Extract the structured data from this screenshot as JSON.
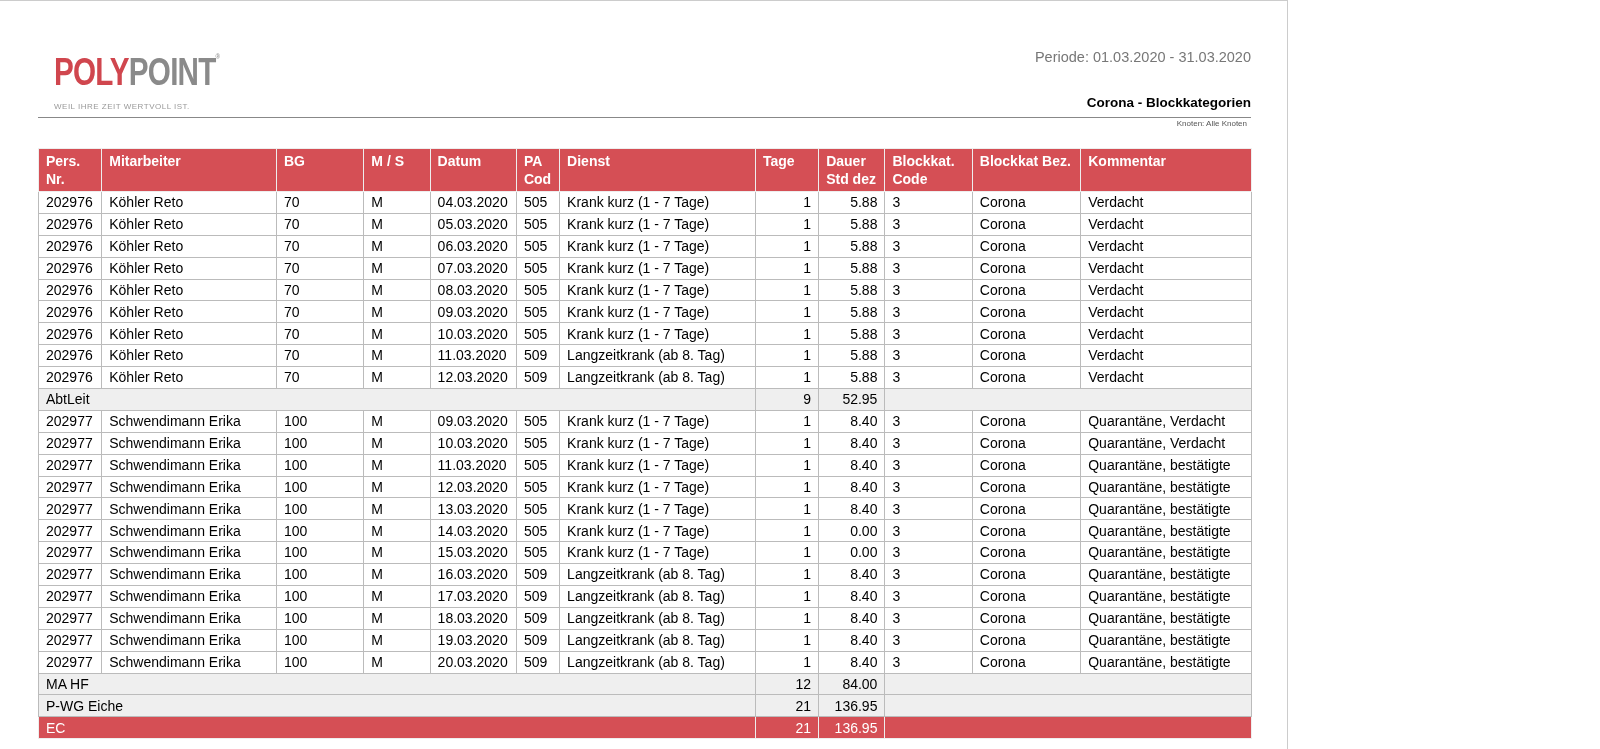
{
  "logo": {
    "part1": "POLY",
    "part2": "POINT",
    "mark": "®",
    "tagline": "WEIL IHRE ZEIT WERTVOLL IST."
  },
  "period": "Periode: 01.03.2020 - 31.03.2020",
  "report_title": "Corona - Blockkategorien",
  "node_filter": "Knoten: Alle Knoten",
  "table": {
    "columns": [
      {
        "label": "Pers. Nr.",
        "kind": "text"
      },
      {
        "label": "Mitarbeiter",
        "kind": "text"
      },
      {
        "label": "BG",
        "kind": "text"
      },
      {
        "label": "M / S",
        "kind": "text"
      },
      {
        "label": "Datum",
        "kind": "text"
      },
      {
        "label": "PA Cod",
        "kind": "text"
      },
      {
        "label": "Dienst",
        "kind": "text"
      },
      {
        "label": "Tage",
        "kind": "number"
      },
      {
        "label": "Dauer Std dez",
        "kind": "number"
      },
      {
        "label": "Blockkat. Code",
        "kind": "text"
      },
      {
        "label": "Blockkat Bez.",
        "kind": "text"
      },
      {
        "label": "Kommentar",
        "kind": "text"
      }
    ],
    "rows": [
      {
        "kind": "data",
        "cells": [
          "202976",
          "Köhler Reto",
          "70",
          "M",
          "04.03.2020",
          "505",
          "Krank kurz (1 - 7 Tage)",
          "1",
          "5.88",
          "3",
          "Corona",
          "Verdacht"
        ]
      },
      {
        "kind": "data",
        "cells": [
          "202976",
          "Köhler Reto",
          "70",
          "M",
          "05.03.2020",
          "505",
          "Krank kurz (1 - 7 Tage)",
          "1",
          "5.88",
          "3",
          "Corona",
          "Verdacht"
        ]
      },
      {
        "kind": "data",
        "cells": [
          "202976",
          "Köhler Reto",
          "70",
          "M",
          "06.03.2020",
          "505",
          "Krank kurz (1 - 7 Tage)",
          "1",
          "5.88",
          "3",
          "Corona",
          "Verdacht"
        ]
      },
      {
        "kind": "data",
        "cells": [
          "202976",
          "Köhler Reto",
          "70",
          "M",
          "07.03.2020",
          "505",
          "Krank kurz (1 - 7 Tage)",
          "1",
          "5.88",
          "3",
          "Corona",
          "Verdacht"
        ]
      },
      {
        "kind": "data",
        "cells": [
          "202976",
          "Köhler Reto",
          "70",
          "M",
          "08.03.2020",
          "505",
          "Krank kurz (1 - 7 Tage)",
          "1",
          "5.88",
          "3",
          "Corona",
          "Verdacht"
        ]
      },
      {
        "kind": "data",
        "cells": [
          "202976",
          "Köhler Reto",
          "70",
          "M",
          "09.03.2020",
          "505",
          "Krank kurz (1 - 7 Tage)",
          "1",
          "5.88",
          "3",
          "Corona",
          "Verdacht"
        ]
      },
      {
        "kind": "data",
        "cells": [
          "202976",
          "Köhler Reto",
          "70",
          "M",
          "10.03.2020",
          "505",
          "Krank kurz (1 - 7 Tage)",
          "1",
          "5.88",
          "3",
          "Corona",
          "Verdacht"
        ]
      },
      {
        "kind": "data",
        "cells": [
          "202976",
          "Köhler Reto",
          "70",
          "M",
          "11.03.2020",
          "509",
          "Langzeitkrank (ab 8. Tag)",
          "1",
          "5.88",
          "3",
          "Corona",
          "Verdacht"
        ]
      },
      {
        "kind": "data",
        "cells": [
          "202976",
          "Köhler Reto",
          "70",
          "M",
          "12.03.2020",
          "509",
          "Langzeitkrank (ab 8. Tag)",
          "1",
          "5.88",
          "3",
          "Corona",
          "Verdacht"
        ]
      },
      {
        "kind": "subtotal",
        "label": "AbtLeit",
        "tage": "9",
        "dauer": "52.95"
      },
      {
        "kind": "data",
        "cells": [
          "202977",
          "Schwendimann Erika",
          "100",
          "M",
          "09.03.2020",
          "505",
          "Krank kurz (1 - 7 Tage)",
          "1",
          "8.40",
          "3",
          "Corona",
          "Quarantäne, Verdacht"
        ]
      },
      {
        "kind": "data",
        "cells": [
          "202977",
          "Schwendimann Erika",
          "100",
          "M",
          "10.03.2020",
          "505",
          "Krank kurz (1 - 7 Tage)",
          "1",
          "8.40",
          "3",
          "Corona",
          "Quarantäne, Verdacht"
        ]
      },
      {
        "kind": "data",
        "cells": [
          "202977",
          "Schwendimann Erika",
          "100",
          "M",
          "11.03.2020",
          "505",
          "Krank kurz (1 - 7 Tage)",
          "1",
          "8.40",
          "3",
          "Corona",
          "Quarantäne, bestätigte"
        ]
      },
      {
        "kind": "data",
        "cells": [
          "202977",
          "Schwendimann Erika",
          "100",
          "M",
          "12.03.2020",
          "505",
          "Krank kurz (1 - 7 Tage)",
          "1",
          "8.40",
          "3",
          "Corona",
          "Quarantäne, bestätigte"
        ]
      },
      {
        "kind": "data",
        "cells": [
          "202977",
          "Schwendimann Erika",
          "100",
          "M",
          "13.03.2020",
          "505",
          "Krank kurz (1 - 7 Tage)",
          "1",
          "8.40",
          "3",
          "Corona",
          "Quarantäne, bestätigte"
        ]
      },
      {
        "kind": "data",
        "cells": [
          "202977",
          "Schwendimann Erika",
          "100",
          "M",
          "14.03.2020",
          "505",
          "Krank kurz (1 - 7 Tage)",
          "1",
          "0.00",
          "3",
          "Corona",
          "Quarantäne, bestätigte"
        ]
      },
      {
        "kind": "data",
        "cells": [
          "202977",
          "Schwendimann Erika",
          "100",
          "M",
          "15.03.2020",
          "505",
          "Krank kurz (1 - 7 Tage)",
          "1",
          "0.00",
          "3",
          "Corona",
          "Quarantäne, bestätigte"
        ]
      },
      {
        "kind": "data",
        "cells": [
          "202977",
          "Schwendimann Erika",
          "100",
          "M",
          "16.03.2020",
          "509",
          "Langzeitkrank (ab 8. Tag)",
          "1",
          "8.40",
          "3",
          "Corona",
          "Quarantäne, bestätigte"
        ]
      },
      {
        "kind": "data",
        "cells": [
          "202977",
          "Schwendimann Erika",
          "100",
          "M",
          "17.03.2020",
          "509",
          "Langzeitkrank (ab 8. Tag)",
          "1",
          "8.40",
          "3",
          "Corona",
          "Quarantäne, bestätigte"
        ]
      },
      {
        "kind": "data",
        "cells": [
          "202977",
          "Schwendimann Erika",
          "100",
          "M",
          "18.03.2020",
          "509",
          "Langzeitkrank (ab 8. Tag)",
          "1",
          "8.40",
          "3",
          "Corona",
          "Quarantäne, bestätigte"
        ]
      },
      {
        "kind": "data",
        "cells": [
          "202977",
          "Schwendimann Erika",
          "100",
          "M",
          "19.03.2020",
          "509",
          "Langzeitkrank (ab 8. Tag)",
          "1",
          "8.40",
          "3",
          "Corona",
          "Quarantäne, bestätigte"
        ]
      },
      {
        "kind": "data",
        "cells": [
          "202977",
          "Schwendimann Erika",
          "100",
          "M",
          "20.03.2020",
          "509",
          "Langzeitkrank (ab 8. Tag)",
          "1",
          "8.40",
          "3",
          "Corona",
          "Quarantäne, bestätigte"
        ]
      },
      {
        "kind": "subtotal",
        "label": "MA HF",
        "tage": "12",
        "dauer": "84.00"
      },
      {
        "kind": "subtotal",
        "label": "P-WG Eiche",
        "tage": "21",
        "dauer": "136.95"
      },
      {
        "kind": "total",
        "label": "EC",
        "tage": "21",
        "dauer": "136.95"
      }
    ]
  }
}
